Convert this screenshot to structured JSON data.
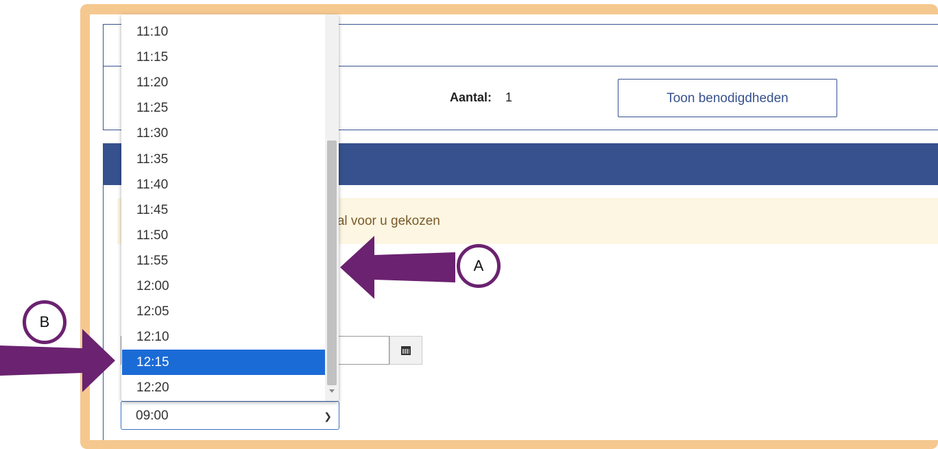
{
  "page": {
    "aantal_label": "Aantal:",
    "aantal_value": "1",
    "toon_button_label": "Toon benodigdheden",
    "warning_text": "d is al voor u gekozen"
  },
  "dropdown": {
    "options": [
      "11:10",
      "11:15",
      "11:20",
      "11:25",
      "11:30",
      "11:35",
      "11:40",
      "11:45",
      "11:50",
      "11:55",
      "12:00",
      "12:05",
      "12:10",
      "12:15",
      "12:20"
    ],
    "selected_option": "12:15"
  },
  "time_select": {
    "value": "09:00"
  },
  "annotations": {
    "a_label": "A",
    "b_label": "B",
    "arrow_color": "#6b2270"
  },
  "colors": {
    "frame": "#f5c88f",
    "primary": "#37518f",
    "selection": "#1b6bd6",
    "warning_bg": "#fcf6e2"
  }
}
